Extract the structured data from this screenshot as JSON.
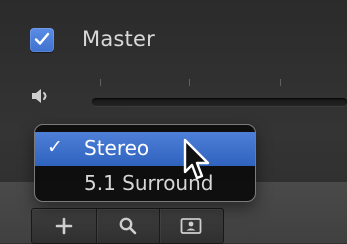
{
  "master": {
    "label": "Master",
    "checked": true
  },
  "volume": {
    "icon": "speaker-icon"
  },
  "menu": {
    "items": [
      {
        "label": "Stereo",
        "selected": true,
        "check": "✓"
      },
      {
        "label": "5.1 Surround",
        "selected": false,
        "check": ""
      }
    ]
  },
  "toolbar": {
    "buttons": [
      {
        "icon": "plus-icon"
      },
      {
        "icon": "search-icon"
      },
      {
        "icon": "people-icon"
      }
    ]
  },
  "colors": {
    "accent": "#3f72cf",
    "menu_highlight": "#2f63bd"
  }
}
